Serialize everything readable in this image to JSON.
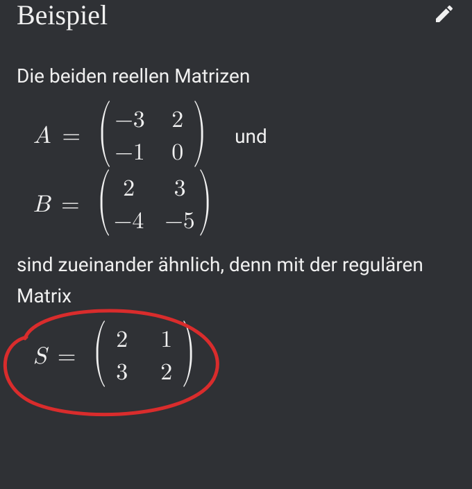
{
  "header": {
    "title": "Beispiel",
    "edit_icon": "pencil-icon"
  },
  "text": {
    "intro": "Die beiden reellen Matrizen",
    "und": "und",
    "mid": "sind zueinander ähnlich, denn mit der regulären Matrix"
  },
  "math": {
    "A": {
      "var": "A",
      "eq": "=",
      "rows": [
        [
          "−3",
          "2"
        ],
        [
          "−1",
          "0"
        ]
      ]
    },
    "B": {
      "var": "B",
      "eq": "=",
      "rows": [
        [
          "2",
          "3"
        ],
        [
          "−4",
          "−5"
        ]
      ]
    },
    "S": {
      "var": "S",
      "eq": "=",
      "rows": [
        [
          "2",
          "1"
        ],
        [
          "3",
          "2"
        ]
      ]
    }
  },
  "annotation": {
    "circled": "S",
    "stroke": "#d92c2c"
  }
}
